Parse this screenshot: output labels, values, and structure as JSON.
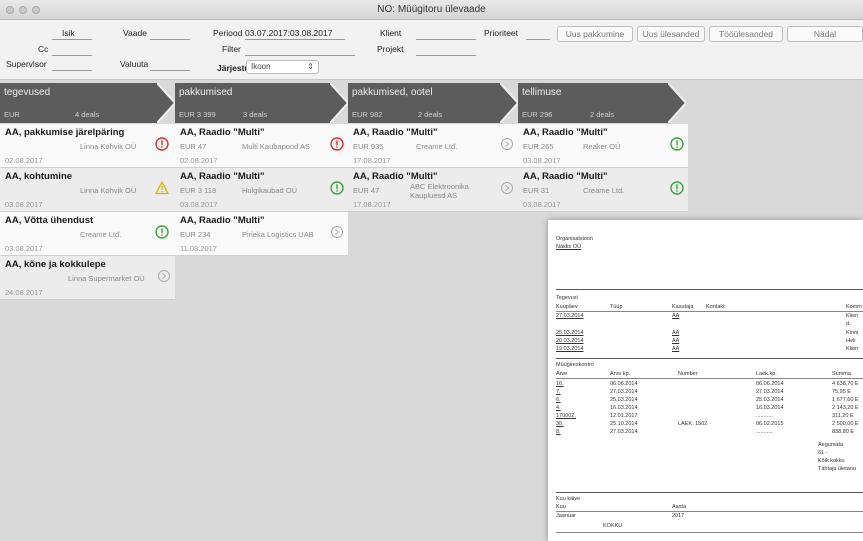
{
  "window": {
    "title": "NO: Müügitoru ülevaade"
  },
  "filters": {
    "isik_label": "Isik",
    "cc_label": "Cc",
    "supervisor_label": "Supervisor",
    "vaade_label": "Vaade",
    "valuuta_label": "Valuuta",
    "periood_label": "Periood",
    "periood_value": "03.07.2017:03.08.2017",
    "filter_label": "Filter",
    "jarjestus_label": "Järjestus",
    "jarjestus_value": "Ikoon",
    "klient_label": "Klient",
    "projekt_label": "Projekt",
    "prioriteet_label": "Prioriteet"
  },
  "toolbar": {
    "uus_pakkumine": "Uus pakkumine",
    "uus_ulesanded": "Uus ülesanded",
    "toolesanded": "Tööülesanded",
    "nadal": "Nädal"
  },
  "columns": [
    {
      "name": "tegevused",
      "currency": "EUR",
      "deals": "4 deals",
      "cards": [
        {
          "title": "AA, pakkumise järelpäring",
          "currency": "",
          "company": "Linna Kohvik OÜ",
          "date": "02.08.2017",
          "icon": "red-exclamation-icon"
        },
        {
          "title": "AA, kohtumine",
          "currency": "",
          "company": "Linna Kohvik OÜ",
          "date": "03.08.2017",
          "icon": "warning-triangle-icon"
        },
        {
          "title": "AA, Võtta ühendust",
          "currency": "",
          "company": "Creame Ltd.",
          "date": "03.08.2017",
          "icon": "green-exclamation-icon"
        },
        {
          "title": "AA, kõne ja kokkulepe",
          "currency": "",
          "company": "Linna Supermarket OÜ",
          "date": "24.08.2017",
          "icon": "grey-arrow-icon"
        }
      ]
    },
    {
      "name": "pakkumised",
      "currency": "EUR 3 399",
      "deals": "3 deals",
      "cards": [
        {
          "title": "AA, Raadio \"Multi\"",
          "currency": "EUR 47",
          "company": "Multi Kaubapood AS",
          "date": "02.08.2017",
          "icon": "red-exclamation-icon"
        },
        {
          "title": "AA, Raadio \"Multi\"",
          "currency": "EUR 3 118",
          "company": "Hulgikaubad OÜ",
          "date": "03.08.2017",
          "icon": "green-exclamation-icon"
        },
        {
          "title": "AA, Raadio \"Multi\"",
          "currency": "EUR 234",
          "company": "Pirieka Logistics UAB",
          "date": "11.08.2017",
          "icon": "grey-arrow-icon"
        }
      ]
    },
    {
      "name": "pakkumised, ootel",
      "currency": "EUR 982",
      "deals": "2 deals",
      "cards": [
        {
          "title": "AA, Raadio \"Multi\"",
          "currency": "EUR 935",
          "company": "Creame Ltd.",
          "date": "17.08.2017",
          "icon": "grey-arrow-icon"
        },
        {
          "title": "AA, Raadio \"Multi\"",
          "currency": "EUR 47",
          "company": "ABC Elektroonika Kaupluesd AS",
          "date": "17.08.2017",
          "icon": "grey-arrow-icon"
        }
      ]
    },
    {
      "name": "tellimuse",
      "currency": "EUR 296",
      "deals": "2 deals",
      "cards": [
        {
          "title": "AA, Raadio \"Multi\"",
          "currency": "EUR 265",
          "company": "Reaker OÜ",
          "date": "03.08.2017",
          "icon": "green-exclamation-icon"
        },
        {
          "title": "AA, Raadio \"Multi\"",
          "currency": "EUR 31",
          "company": "Creame Ltd.",
          "date": "03.08.2017",
          "icon": "green-exclamation-icon"
        }
      ]
    }
  ],
  "report": {
    "org_label": "Organisatsioon",
    "org_value": "Näidis OÜ",
    "tegevused_label": "Tegevusi",
    "tegevused_headers": [
      "Kuupäev",
      "Tüüp",
      "Kasutaja",
      "Kontakt",
      "Komm"
    ],
    "tegevused_rows": [
      [
        "27.03.2014",
        "AA",
        "Klien"
      ],
      [
        "",
        "",
        "d."
      ],
      [
        "25.03.2014",
        "AA",
        "Kinni"
      ],
      [
        "20.03.2014",
        "AA",
        "Heli"
      ],
      [
        "19.03.2014",
        "AA",
        "Klien"
      ]
    ],
    "kontro_label": "Müügireskontro",
    "kontro_headers": [
      "Arve",
      "Arve kp.",
      "Number",
      "Laek.kp.",
      "Summa"
    ],
    "kontro_rows": [
      [
        "16.",
        "06.06.2014",
        "",
        "06.06.2014",
        "4 638,70 E"
      ],
      [
        "7.",
        "27.03.2014",
        "",
        "27.03.2014",
        "75,95 E"
      ],
      [
        "6.",
        "25.03.2014",
        "",
        "25.03.2014",
        "1 677,60 E"
      ],
      [
        "4.",
        "16.03.2014",
        "",
        "16.03.2014",
        "2 143,20 E"
      ],
      [
        "170002.",
        "12.01.2017",
        "",
        "...........",
        "311,20 E"
      ],
      [
        "30.",
        "25.10.2014",
        "LAEK: 1502",
        "06.02.2015",
        "2 500,00 E"
      ],
      [
        "8.",
        "27.03.2014",
        "",
        "...........",
        "838,80 E"
      ]
    ],
    "aegumata_label": "Aegumata",
    "aegumata_value": "61 -",
    "koik_kokku_label": "Kõik kokku",
    "tahtaja_label": "Tähtaja ületanu",
    "kuu_label": "Kuu käive",
    "kuu_headers": [
      "Kuu",
      "Aasta"
    ],
    "kuu_row": [
      "Jaanuar",
      "2017"
    ],
    "kokku_label": "KOKKU"
  },
  "colors": {
    "column_header": "#5c5c5c",
    "red_icon": "#d0312d",
    "green_icon": "#3aa53a",
    "warning_icon": "#e0b000"
  }
}
